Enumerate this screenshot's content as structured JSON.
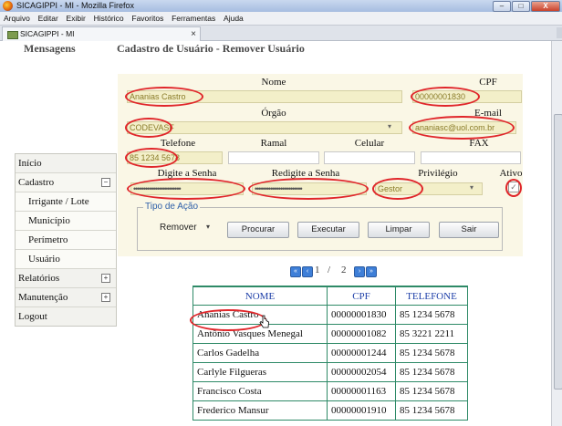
{
  "window": {
    "title": "SICAGIPPI - MI - Mozilla Firefox",
    "controls": {
      "minimize": "–",
      "maximize": "□",
      "close": "X"
    }
  },
  "menu": [
    "Arquivo",
    "Editar",
    "Exibir",
    "Histórico",
    "Favoritos",
    "Ferramentas",
    "Ajuda"
  ],
  "tab": {
    "label": "SICAGIPPI - MI",
    "close": "×"
  },
  "page": {
    "heading": "Mensagens",
    "subtitle": "Cadastro de Usuário - Remover Usuário"
  },
  "sidebar": {
    "items": [
      {
        "label": "Início"
      },
      {
        "label": "Cadastro",
        "toggle": "−"
      },
      {
        "label": "Irrigante / Lote"
      },
      {
        "label": "Município"
      },
      {
        "label": "Perímetro"
      },
      {
        "label": "Usuário"
      },
      {
        "label": "Relatórios",
        "toggle": "+"
      },
      {
        "label": "Manutenção",
        "toggle": "+"
      },
      {
        "label": "Logout"
      }
    ]
  },
  "form": {
    "labels": {
      "nome": "Nome",
      "cpf": "CPF",
      "orgao": "Órgão",
      "email": "E-mail",
      "telefone": "Telefone",
      "ramal": "Ramal",
      "celular": "Celular",
      "fax": "FAX",
      "senha": "Digite a Senha",
      "resenha": "Redigite a Senha",
      "privilegio": "Privilégio",
      "ativo": "Ativo"
    },
    "values": {
      "nome": "Ananias Castro",
      "cpf": "00000001830",
      "orgao": "CODEVASF",
      "email": "ananiasc@uol.com.br",
      "telefone": "85 1234 5678",
      "senha": "••••••••••••••••••••••••",
      "resenha": "••••••••••••••••••••••••",
      "privilegio": "Gestor",
      "ativo": "✓"
    },
    "acao": {
      "legend": "Tipo de Ação",
      "select": "Remover",
      "buttons": {
        "procurar": "Procurar",
        "executar": "Executar",
        "limpar": "Limpar",
        "sair": "Sair"
      }
    }
  },
  "pager": {
    "current": "1",
    "separator": "/",
    "total": "2"
  },
  "table": {
    "headers": [
      "NOME",
      "CPF",
      "TELEFONE"
    ],
    "rows": [
      [
        "Ananias Castro",
        "00000001830",
        "85 1234 5678"
      ],
      [
        "Antônio Vasques Menegal",
        "00000001082",
        "85 3221 2211"
      ],
      [
        "Carlos Gadelha",
        "00000001244",
        "85 1234 5678"
      ],
      [
        "Carlyle Filgueras",
        "00000002054",
        "85 1234 5678"
      ],
      [
        "Francisco Costa",
        "00000001163",
        "85 1234 5678"
      ],
      [
        "Frederico Mansur",
        "00000001910",
        "85 1234 5678"
      ]
    ]
  },
  "colors": {
    "highlight": "#e0262a",
    "form_bg": "#faf7e6",
    "table_border": "#2e8a67",
    "header_text": "#1e3fa8"
  }
}
